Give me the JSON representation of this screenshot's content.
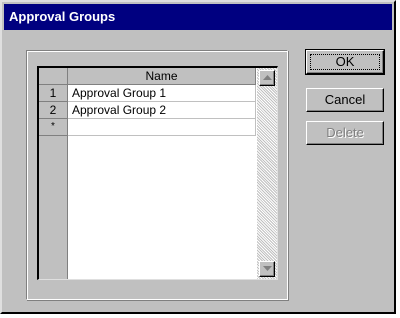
{
  "window": {
    "title": "Approval Groups"
  },
  "grid": {
    "column_header": "Name",
    "rows": [
      {
        "header": "1",
        "name": "Approval Group 1"
      },
      {
        "header": "2",
        "name": "Approval Group 2"
      },
      {
        "header": "*",
        "name": ""
      }
    ]
  },
  "buttons": {
    "ok_label": "OK",
    "cancel_label": "Cancel",
    "delete_label": "Delete"
  },
  "icons": {
    "scroll_up": "triangle-up-icon",
    "scroll_down": "triangle-down-icon"
  },
  "colors": {
    "titlebar": "#000080",
    "face": "#c0c0c0",
    "disabled_text": "#808080"
  }
}
